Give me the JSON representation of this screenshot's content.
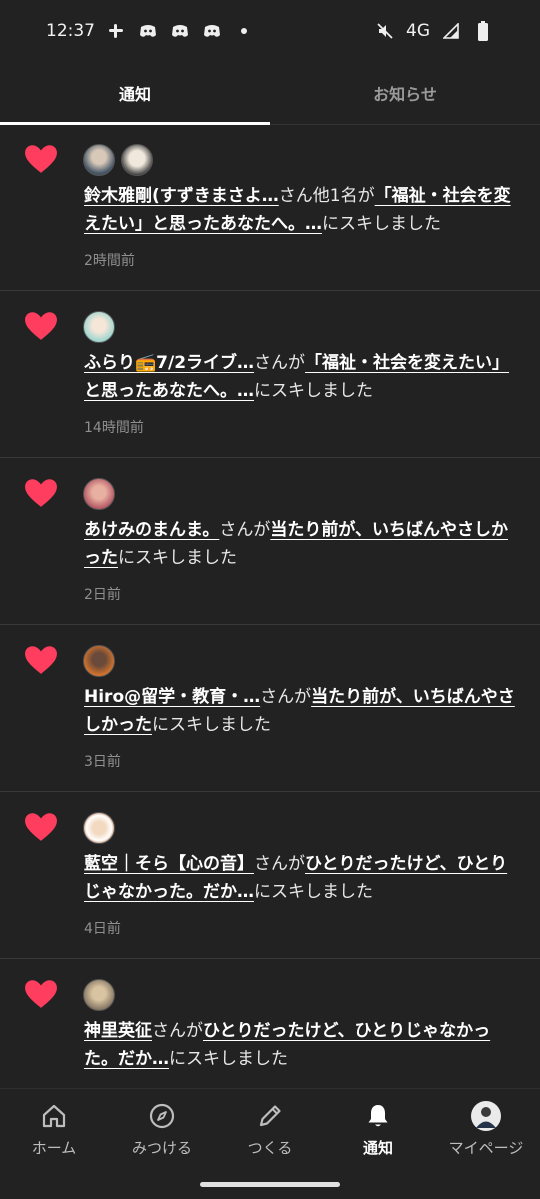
{
  "status_bar": {
    "time": "12:37",
    "network": "4G",
    "left_icons": [
      "slack-icon",
      "discord-icon",
      "discord-icon",
      "discord-icon",
      "dot-icon"
    ],
    "right_icons": [
      "mute-icon",
      "signal-icon",
      "battery-icon"
    ]
  },
  "tabs": [
    {
      "label": "通知",
      "active": true
    },
    {
      "label": "お知らせ",
      "active": false
    }
  ],
  "notifications": [
    {
      "avatars": 2,
      "user": "鈴木雅剛(すずきまさよ…",
      "mid": "さん他1名が",
      "article": "「福祉・社会を変えたい」と思ったあなたへ。…",
      "suffix": "にスキしました",
      "time": "2時間前"
    },
    {
      "avatars": 1,
      "user": "ふらり📻7/2ライブ…",
      "mid": "さんが",
      "article": "「福祉・社会を変えたい」と思ったあなたへ。…",
      "suffix": "にスキしました",
      "time": "14時間前"
    },
    {
      "avatars": 1,
      "user": "あけみのまんま。",
      "mid": "さんが",
      "article": "当たり前が、いちばんやさしかった",
      "suffix": "にスキしました",
      "time": "2日前"
    },
    {
      "avatars": 1,
      "user": "Hiro@留学・教育・…",
      "mid": "さんが",
      "article": "当たり前が、いちばんやさしかった",
      "suffix": "にスキしました",
      "time": "3日前"
    },
    {
      "avatars": 1,
      "user": "藍空｜そら【心の音】",
      "mid": "さんが",
      "article": "ひとりだったけど、ひとりじゃなかった。だか…",
      "suffix": "にスキしました",
      "time": "4日前"
    },
    {
      "avatars": 1,
      "user": "神里英征",
      "mid": "さんが",
      "article": "ひとりだったけど、ひとりじゃなかった。だか…",
      "suffix": "にスキしました",
      "time": ""
    }
  ],
  "nav": [
    {
      "label": "ホーム",
      "icon": "home-icon"
    },
    {
      "label": "みつける",
      "icon": "compass-icon"
    },
    {
      "label": "つくる",
      "icon": "pencil-icon"
    },
    {
      "label": "通知",
      "icon": "bell-icon",
      "active": true
    },
    {
      "label": "マイページ",
      "icon": "profile-avatar-icon"
    }
  ],
  "colors": {
    "background": "#222222",
    "heart": "#ff3d5f",
    "text": "#e8e8e8",
    "muted": "#8f8f8f"
  }
}
